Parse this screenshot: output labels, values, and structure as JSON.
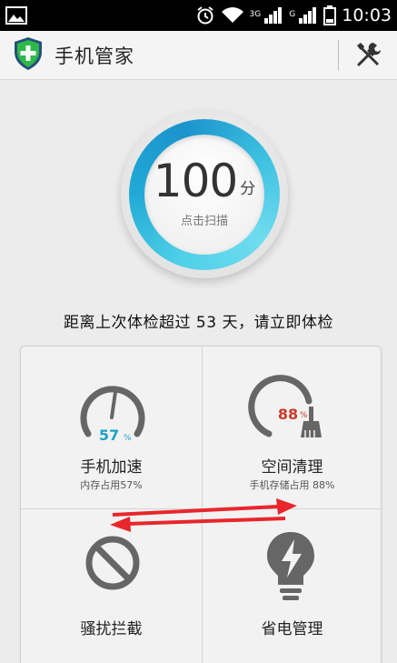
{
  "status_bar": {
    "network_label_1": "3G",
    "network_label_2": "G",
    "time": "10:03"
  },
  "header": {
    "title": "手机管家",
    "icons": {
      "logo": "shield-plus-icon",
      "tools": "tools-icon"
    }
  },
  "score": {
    "value": "100",
    "unit": "分",
    "action": "点击扫描"
  },
  "exam_notice": "距离上次体检超过 53 天，请立即体检",
  "tiles": {
    "speed": {
      "gauge_value": "57",
      "gauge_unit": "%",
      "title": "手机加速",
      "subtitle": "内存占用57%"
    },
    "clean": {
      "gauge_value": "88",
      "gauge_unit": "%",
      "title": "空间清理",
      "subtitle": "手机存储占用 88%"
    },
    "block": {
      "title": "骚扰拦截"
    },
    "power": {
      "title": "省电管理"
    }
  },
  "colors": {
    "accent_blue": "#21a9d6",
    "speed_teal": "#1aa3c9",
    "clean_red": "#c93a2a",
    "arrow_red": "#e8262b",
    "shield_green": "#2fb84a"
  }
}
